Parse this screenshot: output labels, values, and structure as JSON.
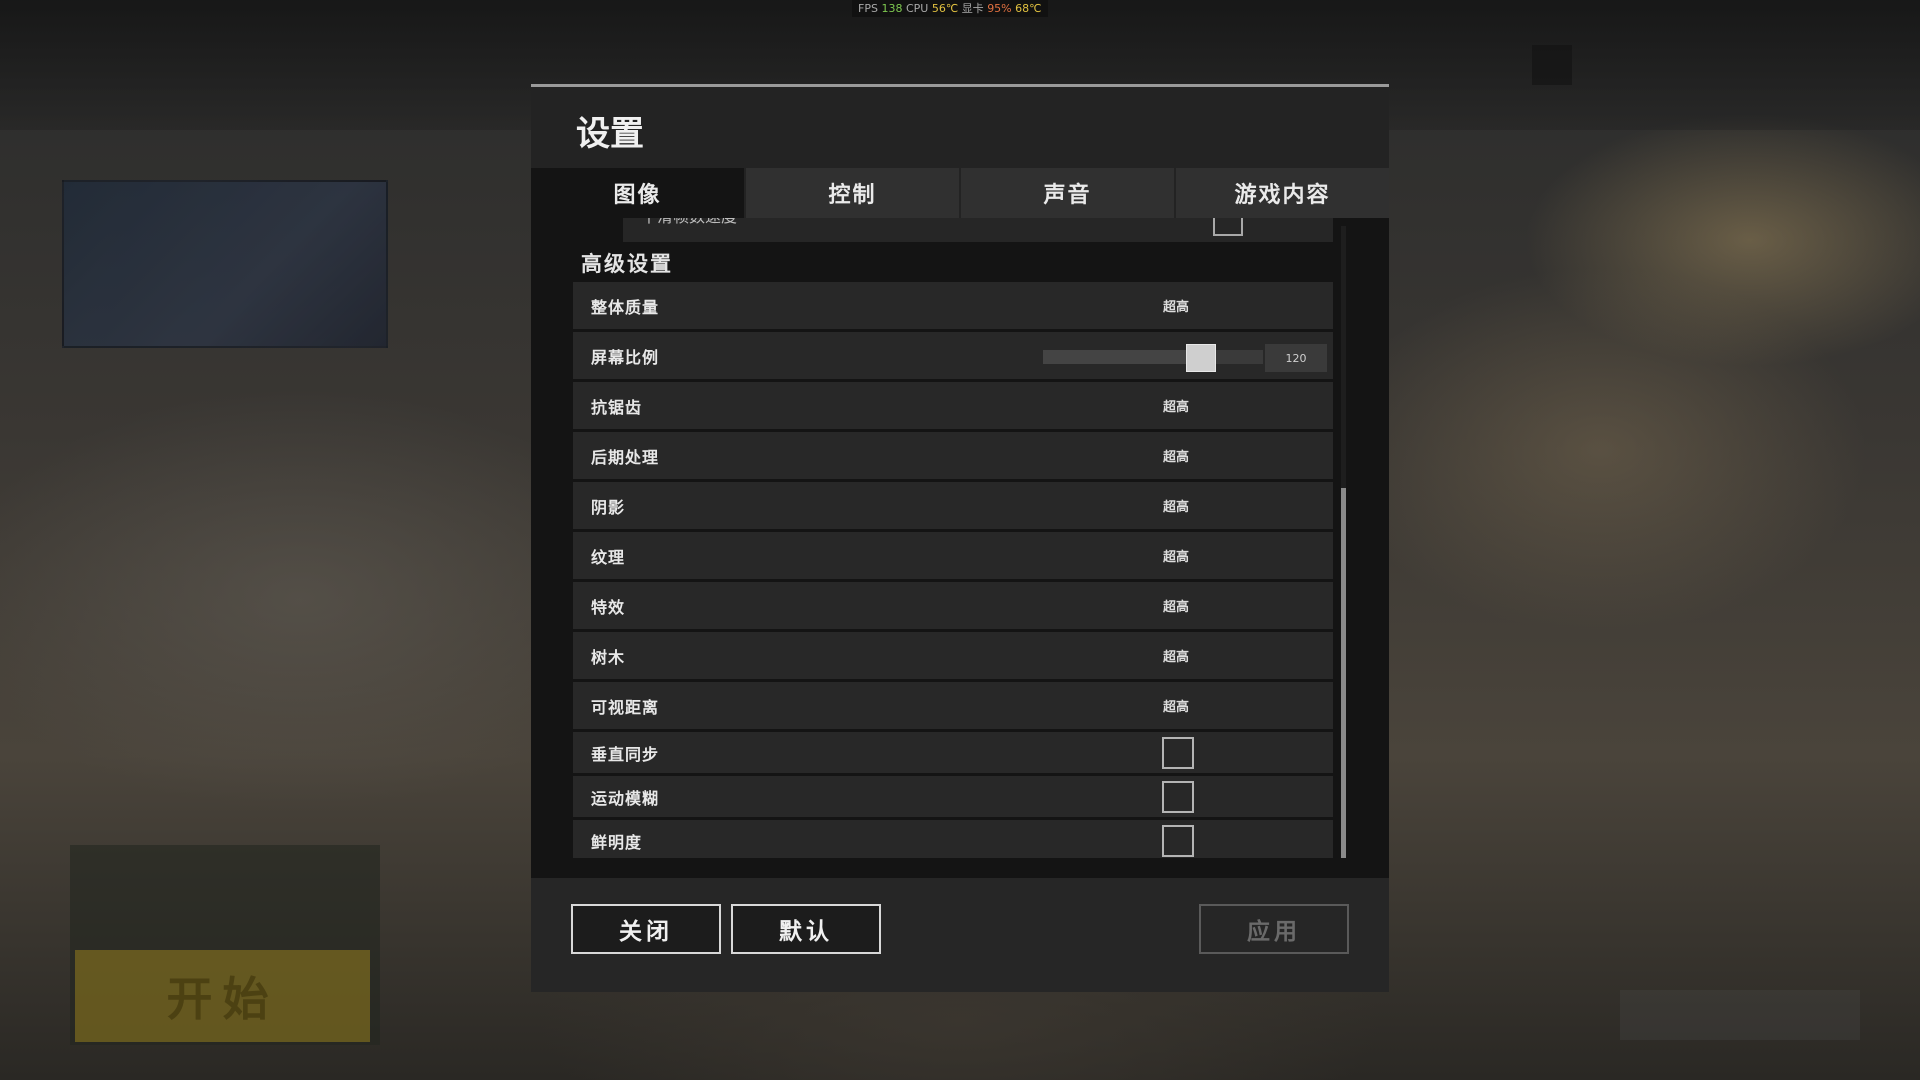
{
  "hud": {
    "fps_label": "FPS",
    "fps_value": "138",
    "cpu_label": "CPU",
    "cpu_temp": "56℃",
    "gpu_label": "显卡",
    "gpu_load": "95%",
    "gpu_temp": "68℃"
  },
  "background": {
    "start_label": "开始"
  },
  "dialog": {
    "title": "设置",
    "tabs": [
      {
        "label": "图像",
        "active": true
      },
      {
        "label": "控制",
        "active": false
      },
      {
        "label": "声音",
        "active": false
      },
      {
        "label": "游戏内容",
        "active": false
      }
    ],
    "cutoff_row_label": "平滑帧数速度",
    "section_title": "高级设置",
    "rows": [
      {
        "label": "整体质量",
        "type": "select",
        "value": "超高"
      },
      {
        "label": "屏幕比例",
        "type": "slider",
        "value": "120",
        "fraction": 0.75
      },
      {
        "label": "抗锯齿",
        "type": "select",
        "value": "超高"
      },
      {
        "label": "后期处理",
        "type": "select",
        "value": "超高"
      },
      {
        "label": "阴影",
        "type": "select",
        "value": "超高"
      },
      {
        "label": "纹理",
        "type": "select",
        "value": "超高"
      },
      {
        "label": "特效",
        "type": "select",
        "value": "超高"
      },
      {
        "label": "树木",
        "type": "select",
        "value": "超高"
      },
      {
        "label": "可视距离",
        "type": "select",
        "value": "超高"
      },
      {
        "label": "垂直同步",
        "type": "checkbox",
        "checked": false
      },
      {
        "label": "运动模糊",
        "type": "checkbox",
        "checked": false
      },
      {
        "label": "鲜明度",
        "type": "checkbox",
        "checked": false
      }
    ],
    "buttons": {
      "close": "关闭",
      "default": "默认",
      "apply": "应用"
    }
  }
}
